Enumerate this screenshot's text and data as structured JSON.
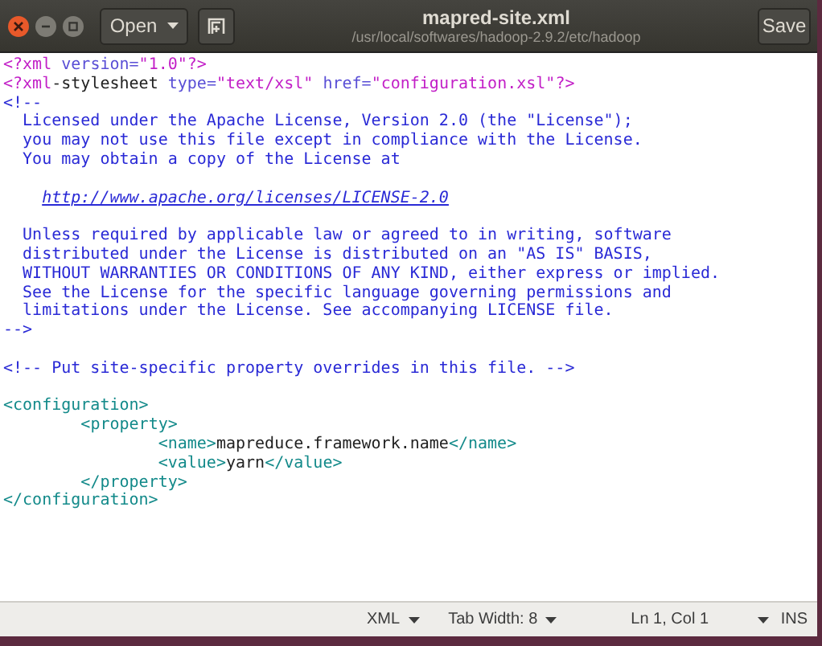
{
  "header": {
    "open_button": {
      "label": "Open"
    },
    "title": "mapred-site.xml",
    "subtitle": "/usr/local/softwares/hadoop-2.9.2/etc/hadoop",
    "save_button": {
      "label": "Save"
    }
  },
  "editor": {
    "lines": [
      {
        "kind": "code",
        "segments": [
          {
            "kind": "pi",
            "text": "<?xml"
          },
          {
            "kind": "attr",
            "text": " version="
          },
          {
            "kind": "string",
            "text": "\"1.0\""
          },
          {
            "kind": "pi",
            "text": "?>"
          }
        ]
      },
      {
        "kind": "code",
        "segments": [
          {
            "kind": "pi",
            "text": "<?xml"
          },
          {
            "kind": "plain",
            "text": "-stylesheet "
          },
          {
            "kind": "attr",
            "text": "type="
          },
          {
            "kind": "string",
            "text": "\"text/xsl\""
          },
          {
            "kind": "attr",
            "text": " href="
          },
          {
            "kind": "string",
            "text": "\"configuration.xsl\""
          },
          {
            "kind": "pi",
            "text": "?>"
          }
        ]
      },
      {
        "kind": "code",
        "segments": [
          {
            "kind": "comment",
            "text": "<!--"
          }
        ]
      },
      {
        "kind": "code",
        "segments": [
          {
            "kind": "comment",
            "text": "  Licensed under the Apache License, Version 2.0 (the \"License\");"
          }
        ]
      },
      {
        "kind": "code",
        "segments": [
          {
            "kind": "comment",
            "text": "  you may not use this file except in compliance with the License."
          }
        ]
      },
      {
        "kind": "code",
        "segments": [
          {
            "kind": "comment",
            "text": "  You may obtain a copy of the License at"
          }
        ]
      },
      {
        "kind": "blank"
      },
      {
        "kind": "code",
        "segments": [
          {
            "kind": "link",
            "text": "    http://www.apache.org/licenses/LICENSE-2.0"
          }
        ]
      },
      {
        "kind": "blank"
      },
      {
        "kind": "code",
        "segments": [
          {
            "kind": "comment",
            "text": "  Unless required by applicable law or agreed to in writing, software"
          }
        ]
      },
      {
        "kind": "code",
        "segments": [
          {
            "kind": "comment",
            "text": "  distributed under the License is distributed on an \"AS IS\" BASIS,"
          }
        ]
      },
      {
        "kind": "code",
        "segments": [
          {
            "kind": "comment",
            "text": "  WITHOUT WARRANTIES OR CONDITIONS OF ANY KIND, either express or implied."
          }
        ]
      },
      {
        "kind": "code",
        "segments": [
          {
            "kind": "comment",
            "text": "  See the License for the specific language governing permissions and"
          }
        ]
      },
      {
        "kind": "code",
        "segments": [
          {
            "kind": "comment",
            "text": "  limitations under the License. See accompanying LICENSE file."
          }
        ]
      },
      {
        "kind": "code",
        "segments": [
          {
            "kind": "comment",
            "text": "-->"
          }
        ]
      },
      {
        "kind": "blank"
      },
      {
        "kind": "code",
        "segments": [
          {
            "kind": "comment",
            "text": "<!-- Put site-specific property overrides in this file. -->"
          }
        ]
      },
      {
        "kind": "blank"
      },
      {
        "kind": "code",
        "segments": [
          {
            "kind": "tag",
            "text": "<configuration>"
          }
        ]
      },
      {
        "kind": "code",
        "segments": [
          {
            "kind": "tag",
            "text": "\t<property>"
          }
        ]
      },
      {
        "kind": "code",
        "segments": [
          {
            "kind": "tag",
            "text": "\t\t<name>"
          },
          {
            "kind": "plain",
            "text": "mapreduce.framework.name"
          },
          {
            "kind": "tag",
            "text": "</name>"
          }
        ]
      },
      {
        "kind": "code",
        "segments": [
          {
            "kind": "tag",
            "text": "\t\t<value>"
          },
          {
            "kind": "plain",
            "text": "yarn"
          },
          {
            "kind": "tag",
            "text": "</value>"
          }
        ]
      },
      {
        "kind": "code",
        "segments": [
          {
            "kind": "tag",
            "text": "\t</property>"
          }
        ]
      },
      {
        "kind": "code",
        "segments": [
          {
            "kind": "tag",
            "text": "</configuration>"
          }
        ]
      }
    ]
  },
  "status_bar": [
    {
      "kind": "dropdown",
      "label": "XML"
    },
    {
      "kind": "dropdown",
      "label": "Tab Width: 8"
    },
    {
      "kind": "text",
      "label": "Ln 1, Col 1"
    },
    {
      "kind": "caret"
    },
    {
      "kind": "text",
      "label": "INS"
    }
  ]
}
